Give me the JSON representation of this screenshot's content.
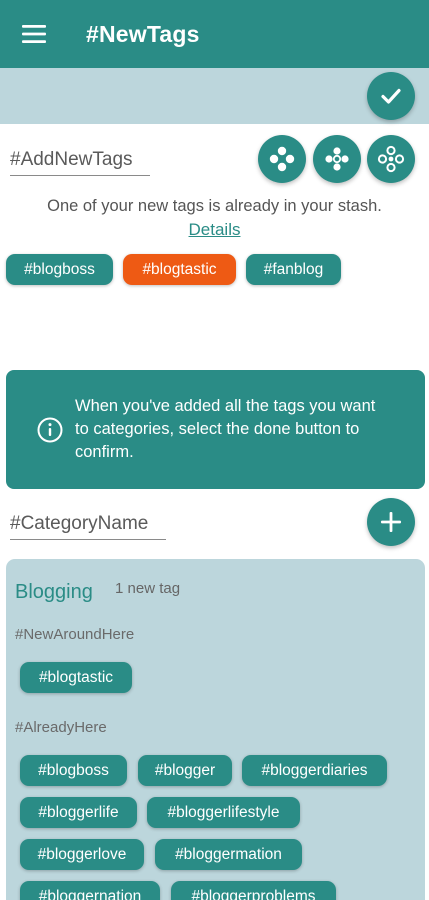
{
  "header": {
    "title": "#NewTags",
    "menu_icon": "hamburger-menu-icon"
  },
  "toolbar": {
    "confirm_icon": "checkmark-icon"
  },
  "add_tags": {
    "placeholder": "#AddNewTags",
    "tool_icons": [
      "four-dots-cluster-icon",
      "five-dots-cluster-icon",
      "six-dots-cluster-icon"
    ]
  },
  "notice": {
    "message": "One of your new tags is already in your stash.",
    "details_link": "Details"
  },
  "new_tags": [
    {
      "label": "#blogboss",
      "highlighted": false
    },
    {
      "label": "#blogtastic",
      "highlighted": true
    },
    {
      "label": "#fanblog",
      "highlighted": false
    }
  ],
  "info": {
    "icon": "info-icon",
    "text": "When you've added all the tags you want to categories, select the done button to confirm."
  },
  "category_input": {
    "placeholder": "#CategoryName",
    "add_icon": "plus-icon"
  },
  "category": {
    "name": "Blogging",
    "count_label": "1 new tag",
    "new_section_label": "#NewAroundHere",
    "new_tags": [
      "#blogtastic"
    ],
    "existing_section_label": "#AlreadyHere",
    "existing_tags": [
      "#blogboss",
      "#blogger",
      "#bloggerdiaries",
      "#bloggerlife",
      "#bloggerlifestyle",
      "#bloggerlove",
      "#bloggermation",
      "#bloggernation",
      "#bloggerproblems"
    ]
  },
  "colors": {
    "primary": "#2a8c86",
    "highlight": "#ee5a14",
    "panel": "#bcd6dc"
  }
}
